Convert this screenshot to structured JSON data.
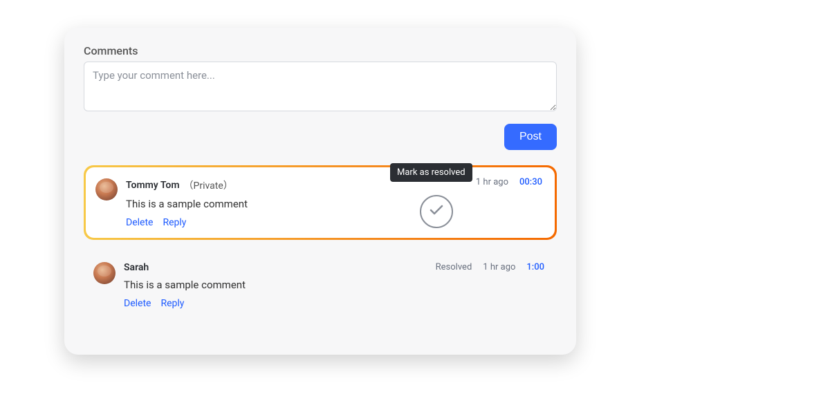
{
  "section_title": "Comments",
  "input": {
    "placeholder": "Type your comment here..."
  },
  "post_label": "Post",
  "tooltip": "Mark as resolved",
  "actions": {
    "delete": "Delete",
    "reply": "Reply"
  },
  "comments": [
    {
      "author": "Tommy Tom",
      "privacy": "（Private）",
      "age": "1 hr ago",
      "timestamp": "00:30",
      "text": "This is a sample comment",
      "status": ""
    },
    {
      "author": "Sarah",
      "privacy": "",
      "age": "1 hr ago",
      "timestamp": "1:00",
      "text": "This is a sample comment",
      "status": "Resolved"
    }
  ]
}
